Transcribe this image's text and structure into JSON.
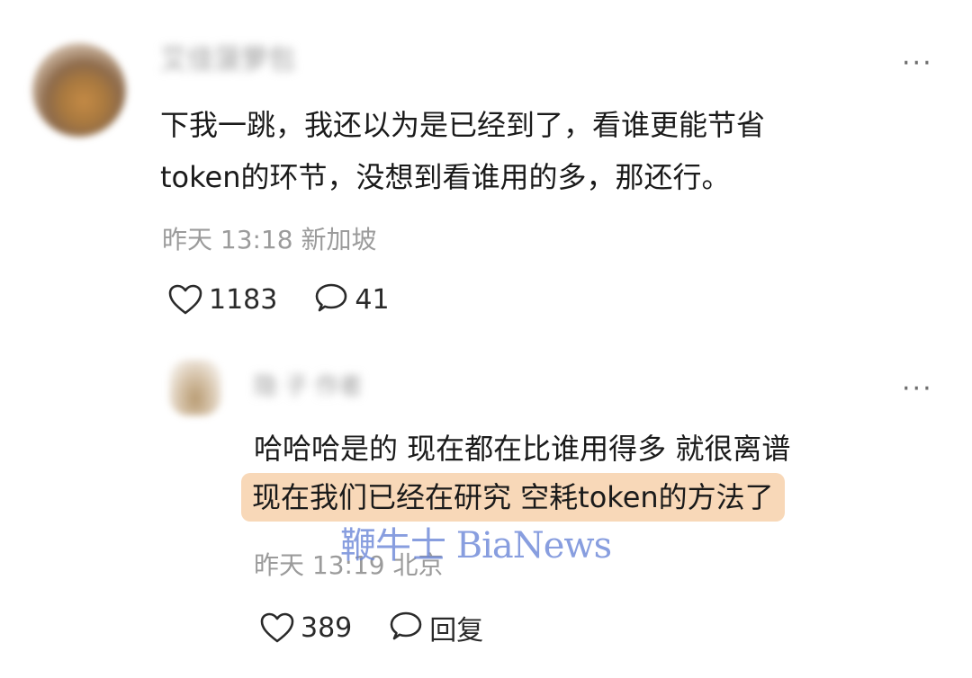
{
  "main_comment": {
    "username": "艾佳菠萝包",
    "more_label": "···",
    "text_line1": "下我一跳，我还以为是已经到了，看谁更能节省",
    "text_line2": "token的环节，没想到看谁用的多，那还行。",
    "date": "昨天",
    "time": "13:18",
    "location": "新加坡",
    "likes": "1183",
    "replies": "41"
  },
  "reply_comment": {
    "username": "隐 子  作者",
    "more_label": "···",
    "text_line1": "哈哈哈是的 现在都在比谁用得多 就很离谱",
    "text_line2": "现在我们已经在研究 空耗token的方法了",
    "highlight_color": "#f8d8b8",
    "date": "昨天",
    "time": "13:19",
    "location": "北京",
    "likes": "389",
    "reply_label": "回复"
  },
  "watermark": "鞭牛士 BiaNews",
  "icons": {
    "like": "heart-outline-icon",
    "comment": "speech-bubble-icon",
    "more": "ellipsis-icon"
  }
}
